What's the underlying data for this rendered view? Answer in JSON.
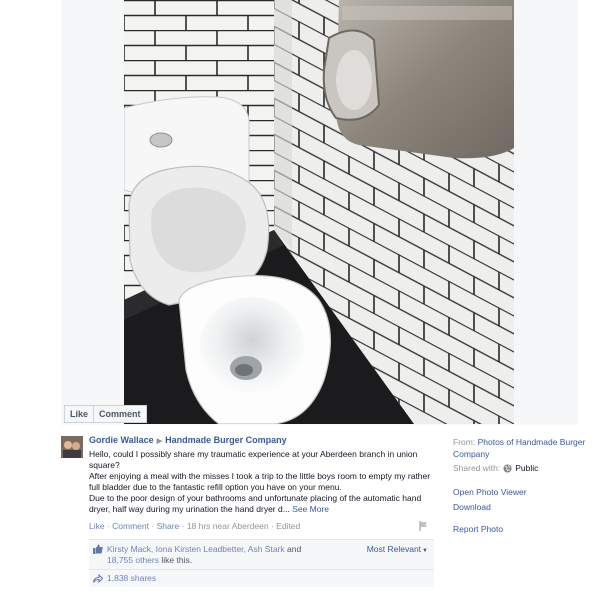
{
  "photo_actions": {
    "like": "Like",
    "comment": "Comment"
  },
  "post": {
    "author": "Gordie Wallace",
    "target": "Handmade Burger Company",
    "paragraphs": [
      "Hello, could I possibly share my traumatic experience at your Aberdeen branch in union square?",
      "After enjoying a meal with the misses I took a trip to the little boys room to empty my rather full bladder due to the fantastic refill option you have on your menu.",
      "Due to the poor design of your bathrooms and unfortunate placing of the automatic hand dryer, half way during my urination the hand dryer d..."
    ],
    "see_more": "See More",
    "meta": {
      "like": "Like",
      "comment": "Comment",
      "share": "Share",
      "sep": " · ",
      "time": "18 hrs near",
      "place": "Aberdeen",
      "edited": "Edited"
    },
    "likes": {
      "names": "Kirsty Mack, Iona Kirsten Leadbetter, Ash Stark",
      "and": " and ",
      "others": "18,755 others",
      "suffix": " like this.",
      "sort_label": "Most Relevant"
    },
    "shares": "1,838 shares"
  },
  "side": {
    "from_label": "From:",
    "from_value": "Photos of Handmade Burger Company",
    "shared_label": "Shared with:",
    "audience": "Public",
    "open_viewer": "Open Photo Viewer",
    "download": "Download",
    "report": "Report Photo"
  },
  "colors": {
    "link": "#3b5998",
    "muted": "#90949c",
    "ufi_bg": "#f6f7f9"
  },
  "icons": [
    "like-thumb-icon",
    "share-arrow-icon",
    "globe-icon",
    "flag-icon",
    "chevron-down-icon"
  ]
}
